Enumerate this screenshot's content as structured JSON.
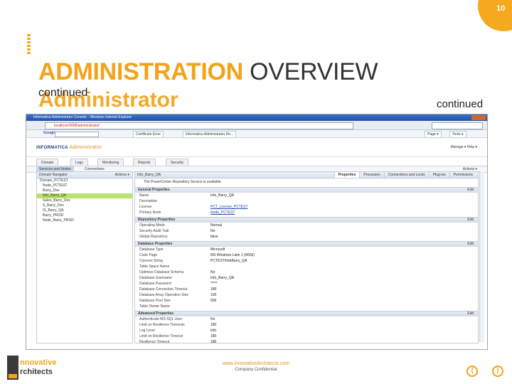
{
  "page_number": "10",
  "title": {
    "part1": "ADMINISTRATION",
    "part2": "OVERVIEW"
  },
  "subtitle": {
    "continued_small": "continued",
    "heading": "Administrator",
    "continued_right": "continued"
  },
  "screenshot": {
    "window_title": "Informatica Administrator Console - Windows Internet Explorer",
    "address_url": "localhost:6008/administrator/",
    "toolbar": {
      "google": "Google",
      "tabs": [
        "Certificate Error",
        "Informatica Administrator Ho...",
        "Page ▾",
        "Tools ▾"
      ]
    },
    "header": {
      "logo_brand": "INFORMATICA",
      "logo_product": "Administrator",
      "user_links": "Manage ▾   Help ▾"
    },
    "main_tabs": [
      "Domain",
      "Logs",
      "Monitoring",
      "Reports",
      "Security"
    ],
    "subbar": {
      "active": "Services and Nodes",
      "second": "Connections",
      "actions": "Actions ▾"
    },
    "navigator": {
      "title": "Domain Navigator",
      "actions": "Actions ▾",
      "items": [
        "Domain_PCTEST",
        "Node_PCTEST",
        "Barry_Dev",
        "Info_Barry_QA",
        "Sales_Barry_Dev",
        "S_Barry_Dev",
        "IS_Barry_QA",
        "Barry_PROD",
        "Node_Barry_PROD"
      ]
    },
    "main": {
      "title": "Info_Barry_QA",
      "tabs": [
        "Properties",
        "Processes",
        "Connections and Locks",
        "Plug-ins",
        "Permissions"
      ],
      "message": "The PowerCenter Repository Service is available.",
      "sections": [
        {
          "name": "General Properties",
          "edit": "Edit",
          "rows": [
            {
              "k": "Name",
              "v": "Info_Barry_QA"
            },
            {
              "k": "Description",
              "v": ""
            },
            {
              "k": "License",
              "v": "PCT_License_PCTEST",
              "link": true
            },
            {
              "k": "Primary Node",
              "v": "Node_PCTEST",
              "link": true
            }
          ]
        },
        {
          "name": "Repository Properties",
          "edit": "Edit",
          "rows": [
            {
              "k": "Operating Mode",
              "v": "Normal"
            },
            {
              "k": "Security Audit Trail",
              "v": "No"
            },
            {
              "k": "Global Repository",
              "v": "false"
            }
          ]
        },
        {
          "name": "Database Properties",
          "edit": "Edit",
          "rows": [
            {
              "k": "Database Type",
              "v": "Microsoft"
            },
            {
              "k": "Code Page",
              "v": "MS Windows Latin 1 (ANSI)"
            },
            {
              "k": "Connect String",
              "v": "PCTEST/InfaBarry_QA"
            },
            {
              "k": "Table Space Name",
              "v": ""
            },
            {
              "k": "Optimize Database Schema",
              "v": "No"
            },
            {
              "k": "Database Username",
              "v": "Info_Barry_QA"
            },
            {
              "k": "Database Password",
              "v": "*****"
            },
            {
              "k": "Database Connection Timeout",
              "v": "180"
            },
            {
              "k": "Database Array Operation Size",
              "v": "100"
            },
            {
              "k": "Database Pool Size",
              "v": "500"
            },
            {
              "k": "Table Owner Name",
              "v": ""
            }
          ]
        },
        {
          "name": "Advanced Properties",
          "edit": "Edit",
          "rows": [
            {
              "k": "Authenticate MS-SQL User",
              "v": "No"
            },
            {
              "k": "Limit on Resilience Timeouts",
              "v": "180"
            },
            {
              "k": "Log Level",
              "v": "Info"
            },
            {
              "k": "Limit on Resilience Timeout",
              "v": "180"
            },
            {
              "k": "Resilience Timeout",
              "v": "180"
            }
          ]
        }
      ]
    }
  },
  "footer": {
    "logo_line1": "nnovative",
    "logo_line2": "rchitects",
    "url": "www.innovativeArchitects.com",
    "confidential": "Company Confidential",
    "prev": "⟨",
    "next": "⟩"
  },
  "colors": {
    "accent": "#f2a31a",
    "dark": "#3a3a3a",
    "selected": "#b9e36a"
  }
}
